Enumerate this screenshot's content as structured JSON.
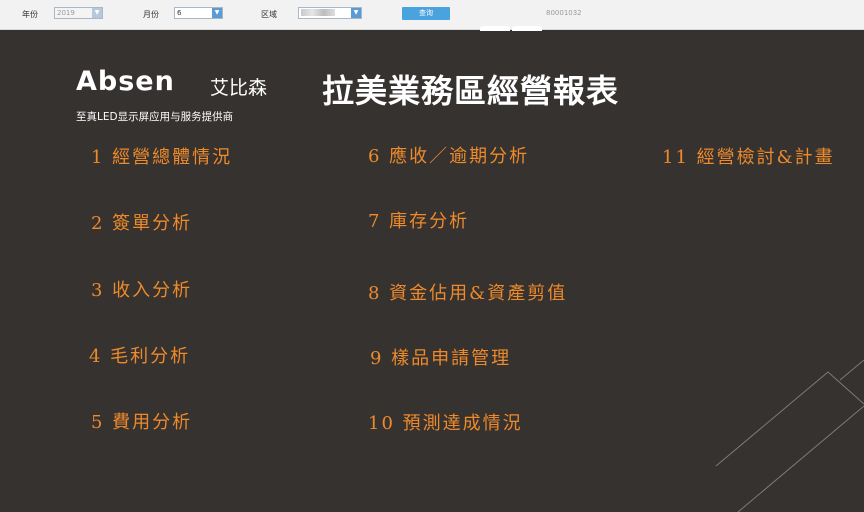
{
  "filters": {
    "year_label": "年份",
    "year_value": "2019",
    "month_label": "月份",
    "month_value": "6",
    "region_label": "区域",
    "query_label": "查询",
    "code_text": "80001032"
  },
  "logo": {
    "word": "Absen",
    "cn_name": "艾比森",
    "slogan": "至真LED显示屏应用与服务提供商"
  },
  "title": "拉美業務區經營報表",
  "menu": {
    "col1": [
      "1 經營總體情況",
      "2 簽單分析",
      "3 收入分析",
      "4 毛利分析",
      "5 費用分析"
    ],
    "col2": [
      "6 應收／逾期分析",
      "7 庫存分析",
      "8 資金佔用&資產剪值",
      "9 樣品申請管理",
      "10 預測達成情況"
    ],
    "col3": [
      "11 經營檢討&計畫"
    ]
  },
  "colors": {
    "background": "#353230",
    "menu_text": "#ee8a2a",
    "title_text": "#ffffff",
    "query_button": "#4aa3df"
  }
}
